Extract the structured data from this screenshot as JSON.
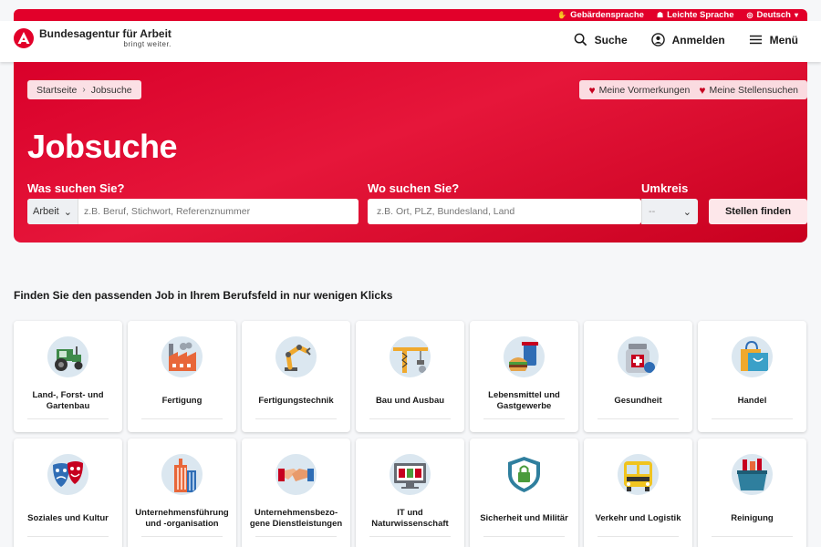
{
  "topbar": {
    "sign_language": "Gebärdensprache",
    "easy_language": "Leichte Sprache",
    "language": "Deutsch"
  },
  "header": {
    "logo_name": "Bundesagentur für Arbeit",
    "logo_claim": "bringt weiter.",
    "search": "Suche",
    "login": "Anmelden",
    "menu": "Menü"
  },
  "breadcrumb": {
    "home": "Startseite",
    "current": "Jobsuche"
  },
  "favorites": {
    "saved": "Meine Vormerkungen",
    "searches": "Meine Stellensuchen"
  },
  "hero": {
    "title": "Jobsuche",
    "what_label": "Was suchen Sie?",
    "where_label": "Wo suchen Sie?",
    "radius_label": "Umkreis",
    "type_value": "Arbeit",
    "what_placeholder": "z.B. Beruf, Stichwort, Referenznummer",
    "where_placeholder": "z.B. Ort, PLZ, Bundesland, Land",
    "radius_value": "--",
    "submit": "Stellen finden"
  },
  "section": {
    "title": "Finden Sie den passenden Job in Ihrem Berufsfeld in nur wenigen Klicks"
  },
  "categories": [
    {
      "label": "Land-, Forst- und\nGartenbau",
      "icon": "tractor-icon"
    },
    {
      "label": "Fertigung",
      "icon": "factory-icon"
    },
    {
      "label": "Fertigungstechnik",
      "icon": "robot-arm-icon"
    },
    {
      "label": "Bau und Ausbau",
      "icon": "crane-icon"
    },
    {
      "label": "Lebensmittel und\nGastgewerbe",
      "icon": "food-icon"
    },
    {
      "label": "Gesundheit",
      "icon": "medicine-icon"
    },
    {
      "label": "Handel",
      "icon": "shopping-bag-icon"
    },
    {
      "label": "Soziales und Kultur",
      "icon": "theater-masks-icon"
    },
    {
      "label": "Unternehmensführung\nund -organisation",
      "icon": "office-building-icon"
    },
    {
      "label": "Unternehmensbezo-\ngene Dienstleistungen",
      "icon": "handshake-icon"
    },
    {
      "label": "IT und\nNaturwissenschaft",
      "icon": "computer-monitor-icon"
    },
    {
      "label": "Sicherheit und Militär",
      "icon": "shield-lock-icon"
    },
    {
      "label": "Verkehr und Logistik",
      "icon": "bus-icon"
    },
    {
      "label": "Reinigung",
      "icon": "cleaning-bucket-icon"
    }
  ],
  "colors": {
    "brand_red": "#e2002a",
    "hero_red": "#d9002a",
    "button_light": "#fde7ea"
  }
}
